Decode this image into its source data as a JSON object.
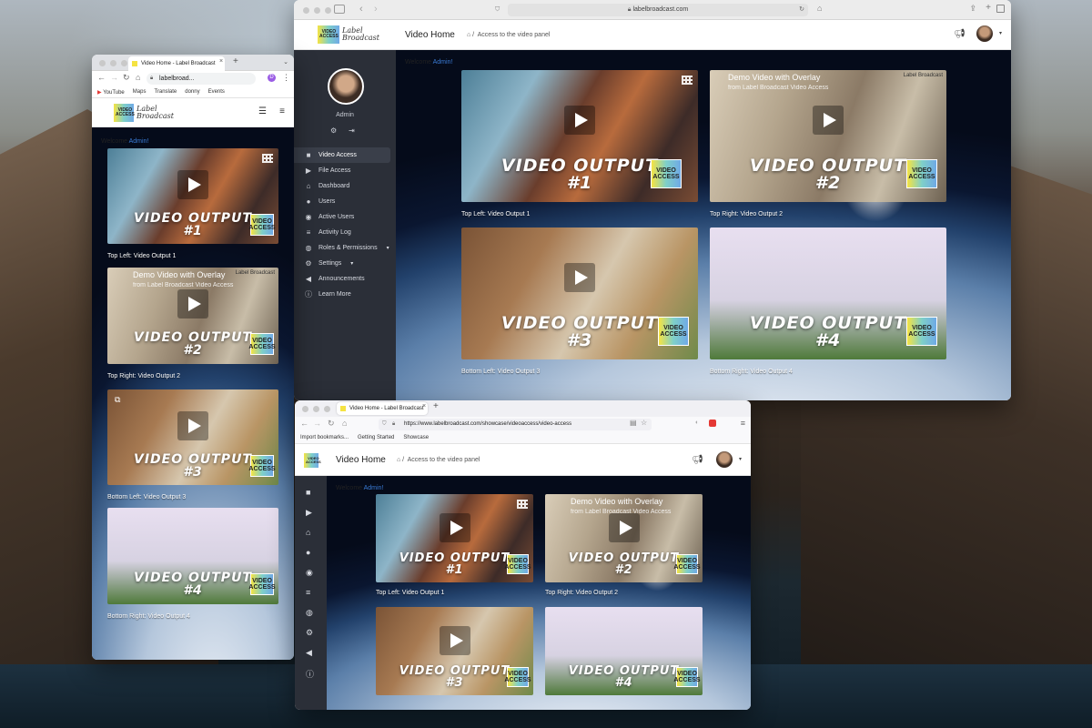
{
  "windows": {
    "large": {
      "url": "labelbroadcast.com",
      "header_title": "Video Home",
      "breadcrumb": "Access to the video panel",
      "welcome_prefix": "Welcome",
      "welcome_user": "Admin!",
      "profile_name": "Admin",
      "nav": [
        {
          "label": "Video Access",
          "icon": "video-camera-icon"
        },
        {
          "label": "File Access",
          "icon": "play-circle-icon"
        },
        {
          "label": "Dashboard",
          "icon": "home-icon"
        },
        {
          "label": "Users",
          "icon": "users-icon"
        },
        {
          "label": "Active Users",
          "icon": "user-circle-icon"
        },
        {
          "label": "Activity Log",
          "icon": "list-icon"
        },
        {
          "label": "Roles & Permissions",
          "icon": "user-tag-icon"
        },
        {
          "label": "Settings",
          "icon": "gears-icon"
        },
        {
          "label": "Announcements",
          "icon": "megaphone-icon"
        },
        {
          "label": "Learn More",
          "icon": "info-circle-icon"
        }
      ]
    },
    "small": {
      "tab_title": "Video Home - Label Broadcast",
      "url": "labelbroad...",
      "bookmarks": [
        "YouTube",
        "Maps",
        "Translate",
        "donny",
        "Events"
      ],
      "welcome_prefix": "Welcome",
      "welcome_user": "Admin!"
    },
    "firefox": {
      "tab_title": "Video Home - Label Broadcast",
      "url": "https://www.labelbroadcast.com/showcase/videoaccess/video-access",
      "bookmarks": [
        "Import bookmarks...",
        "Getting Started",
        "Showcase"
      ],
      "header_title": "Video Home",
      "breadcrumb": "Access to the video panel",
      "welcome_prefix": "Welcome",
      "welcome_user": "Admin!"
    }
  },
  "videos": {
    "label": "VIDEO OUTPUT",
    "badge": "VIDEO ACCESS",
    "demo_title": "Demo Video with Overlay",
    "demo_sub": "from Label Broadcast Video Access",
    "demo_logo": "Label Broadcast",
    "items": [
      {
        "num": "#1",
        "caption": "Top Left: Video Output 1"
      },
      {
        "num": "#2",
        "caption": "Top Right: Video Output 2"
      },
      {
        "num": "#3",
        "caption": "Bottom Left: Video Output 3"
      },
      {
        "num": "#4",
        "caption": "Bottom Right: Video Output 4"
      }
    ]
  },
  "brand": {
    "logo_text": "Label Broadcast",
    "logo_box": "VIDEO ACCESS"
  },
  "colors": {
    "sidebar": "#2b2f38",
    "link": "#3a7bd5",
    "accent_badge": "#f5e342"
  }
}
